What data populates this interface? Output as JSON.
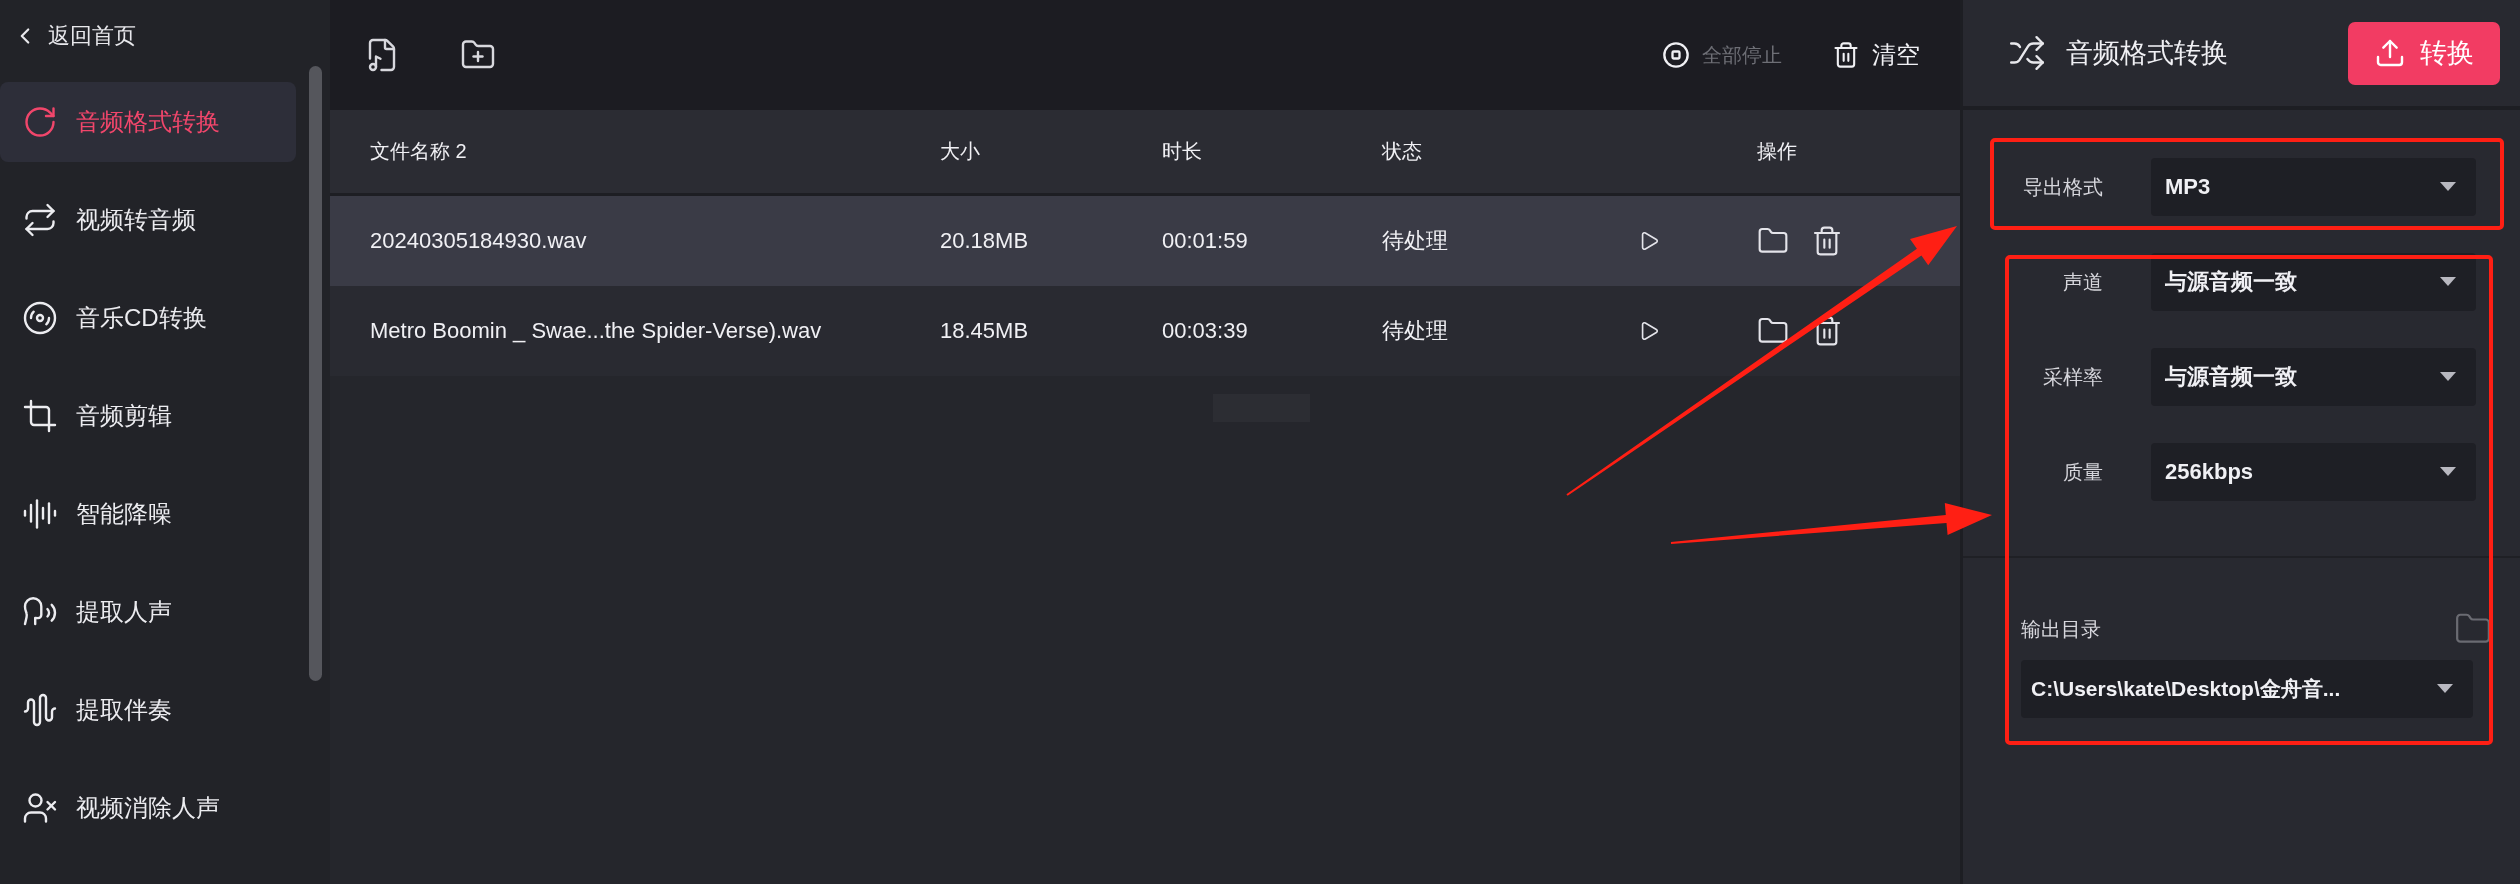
{
  "sidebar": {
    "back": "返回首页",
    "items": [
      {
        "label": "音频格式转换",
        "selected": true
      },
      {
        "label": "视频转音频",
        "selected": false
      },
      {
        "label": "音乐CD转换",
        "selected": false
      },
      {
        "label": "音频剪辑",
        "selected": false
      },
      {
        "label": "智能降噪",
        "selected": false
      },
      {
        "label": "提取人声",
        "selected": false
      },
      {
        "label": "提取伴奏",
        "selected": false
      },
      {
        "label": "视频消除人声",
        "selected": false
      }
    ]
  },
  "toolbar": {
    "stop_all": {
      "label": "全部停止",
      "disabled": true
    },
    "clear": "清空"
  },
  "table": {
    "columns": [
      "文件名称 2",
      "大小",
      "时长",
      "状态",
      "操作"
    ],
    "rows": [
      {
        "name": "20240305184930.wav",
        "size": "20.18MB",
        "duration": "00:01:59",
        "status": "待处理",
        "selected": true
      },
      {
        "name": "Metro Boomin _ Swae...the Spider-Verse).wav",
        "size": "18.45MB",
        "duration": "00:03:39",
        "status": "待处理",
        "selected": false
      }
    ]
  },
  "panel": {
    "title": "音频格式转换",
    "convert_button": "转换",
    "settings": [
      {
        "label": "导出格式",
        "value": "MP3"
      },
      {
        "label": "声道",
        "value": "与源音频一致"
      },
      {
        "label": "采样率",
        "value": "与源音频一致"
      },
      {
        "label": "质量",
        "value": "256kbps"
      }
    ],
    "output_dir": {
      "label": "输出目录",
      "value": "C:\\Users\\kate\\Desktop\\金舟音..."
    }
  }
}
